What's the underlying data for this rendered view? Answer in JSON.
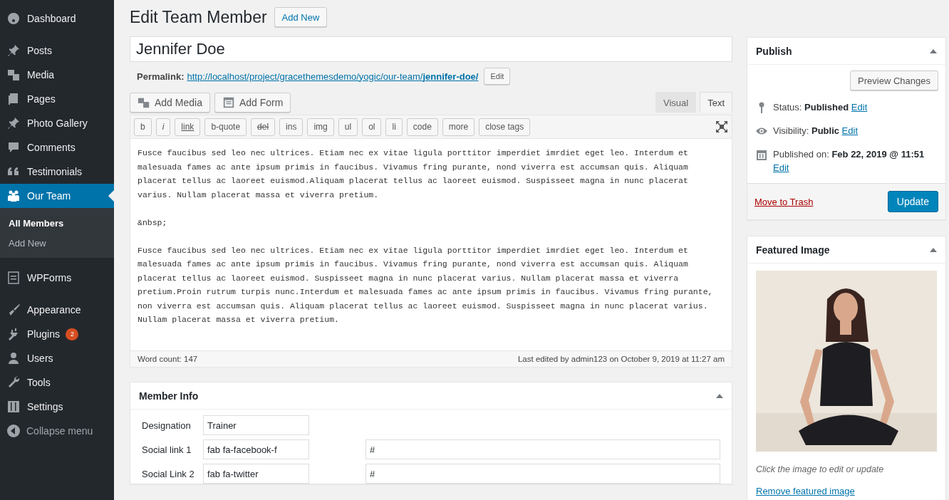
{
  "sidebar": {
    "groups": [
      {
        "items": [
          {
            "label": "Dashboard",
            "selected": false
          }
        ]
      },
      {
        "items": [
          {
            "label": "Posts",
            "selected": false
          },
          {
            "label": "Media",
            "selected": false
          },
          {
            "label": "Pages",
            "selected": false
          },
          {
            "label": "Photo Gallery",
            "selected": false
          },
          {
            "label": "Comments",
            "selected": false
          },
          {
            "label": "Testimonials",
            "selected": false
          },
          {
            "label": "Our Team",
            "selected": true,
            "children": [
              {
                "label": "All Members",
                "selected": true
              },
              {
                "label": "Add New",
                "selected": false
              }
            ]
          }
        ]
      },
      {
        "items": [
          {
            "label": "WPForms",
            "selected": false
          }
        ]
      },
      {
        "items": [
          {
            "label": "Appearance",
            "selected": false
          },
          {
            "label": "Plugins",
            "selected": false,
            "badge": "2"
          },
          {
            "label": "Users",
            "selected": false
          },
          {
            "label": "Tools",
            "selected": false
          },
          {
            "label": "Settings",
            "selected": false
          }
        ]
      }
    ],
    "collapse": "Collapse menu"
  },
  "header": {
    "title": "Edit Team Member",
    "button": "Add New"
  },
  "post_title": "Jennifer Doe",
  "permalink": {
    "label": "Permalink:",
    "url": "http://localhost/project/gracethemesdemo/yogic/our-team/",
    "slug": "jennifer-doe/",
    "button": "Edit"
  },
  "media_buttons": [
    "Add Media",
    "Add Form"
  ],
  "editor_tabs": [
    {
      "label": "Visual",
      "selected": false
    },
    {
      "label": "Text",
      "selected": true
    }
  ],
  "toolbar": [
    {
      "label": "b",
      "kind": "plain"
    },
    {
      "label": "i",
      "kind": "italic"
    },
    {
      "label": "link",
      "kind": "underline"
    },
    {
      "label": "b-quote",
      "kind": "plain"
    },
    {
      "label": "del",
      "kind": "strike"
    },
    {
      "label": "ins",
      "kind": "plain"
    },
    {
      "label": "img",
      "kind": "plain"
    },
    {
      "label": "ul",
      "kind": "plain"
    },
    {
      "label": "ol",
      "kind": "plain"
    },
    {
      "label": "li",
      "kind": "plain"
    },
    {
      "label": "code",
      "kind": "plain"
    },
    {
      "label": "more",
      "kind": "plain"
    },
    {
      "label": "close tags",
      "kind": "plain"
    }
  ],
  "content": [
    {
      "lines": [
        "Fusce faucibus sed leo nec ultrices. Etiam nec ex vitae ligula porttitor imperdiet imrdiet eget leo. Interdum et",
        "malesuada fames ac ante ipsum primis in faucibus. Vivamus fring purante, nond viverra est accumsan quis. Aliquam",
        "placerat tellus ac laoreet euismod.Aliquam placerat tellus ac laoreet euismod. Suspisseet magna in nunc placerat",
        "varius. Nullam placerat massa et viverra pretium."
      ]
    },
    {
      "lines": [
        "&nbsp;"
      ]
    },
    {
      "lines": [
        "Fusce faucibus sed leo nec ultrices. Etiam nec ex vitae ligula porttitor imperdiet imrdiet eget leo. Interdum et",
        "malesuada fames ac ante ipsum primis in faucibus. Vivamus fring purante, nond viverra est accumsan quis. Aliquam",
        "placerat tellus ac laoreet euismod. Suspisseet magna in nunc placerat varius. Nullam placerat massa et viverra",
        "pretium.Proin rutrum turpis nunc.Interdum et malesuada fames ac ante ipsum primis in faucibus. Vivamus fring purante,",
        "non viverra est accumsan quis. Aliquam placerat tellus ac laoreet euismod. Suspisseet magna in nunc placerat varius.",
        "Nullam placerat massa et viverra pretium."
      ]
    }
  ],
  "editor_footer": {
    "word_count": "Word count: 147",
    "last_edited": "Last edited by admin123 on October 9, 2019 at 11:27 am"
  },
  "member_info": {
    "title": "Member Info",
    "rows": [
      {
        "label": "Designation",
        "value": "Trainer"
      },
      {
        "label": "Social link 1",
        "value": "fab fa-facebook-f",
        "link": "#"
      },
      {
        "label": "Social Link 2",
        "value": "fab fa-twitter",
        "link": "#"
      }
    ]
  },
  "publish": {
    "title": "Publish",
    "preview": "Preview Changes",
    "rows": [
      {
        "label": "Status:",
        "value": "Published",
        "link": "Edit"
      },
      {
        "label": "Visibility:",
        "value": "Public",
        "link": "Edit"
      },
      {
        "label": "Published on:",
        "value": "Feb 22, 2019 @ 11:51",
        "link": "Edit"
      }
    ],
    "trash": "Move to Trash",
    "update": "Update"
  },
  "featured_image": {
    "title": "Featured Image",
    "caption": "Click the image to edit or update",
    "remove": "Remove featured image"
  }
}
